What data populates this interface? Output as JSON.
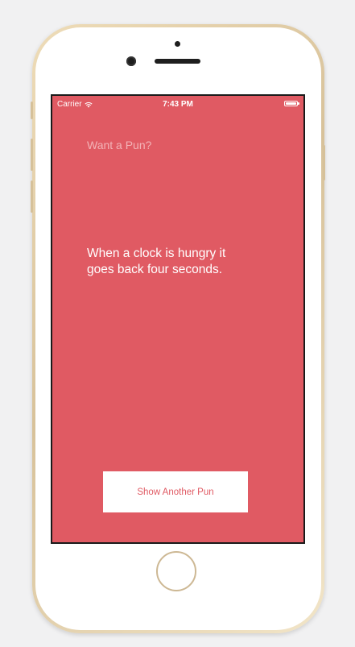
{
  "status_bar": {
    "carrier": "Carrier",
    "time": "7:43 PM"
  },
  "app": {
    "title": "Want a Pun?",
    "pun": "When a clock is hungry it goes back four seconds.",
    "button_label": "Show Another Pun",
    "background_color": "#e05a63",
    "button_text_color": "#e05a63"
  },
  "icons": {
    "wifi": "wifi-icon",
    "battery": "battery-icon",
    "home": "home-button"
  }
}
